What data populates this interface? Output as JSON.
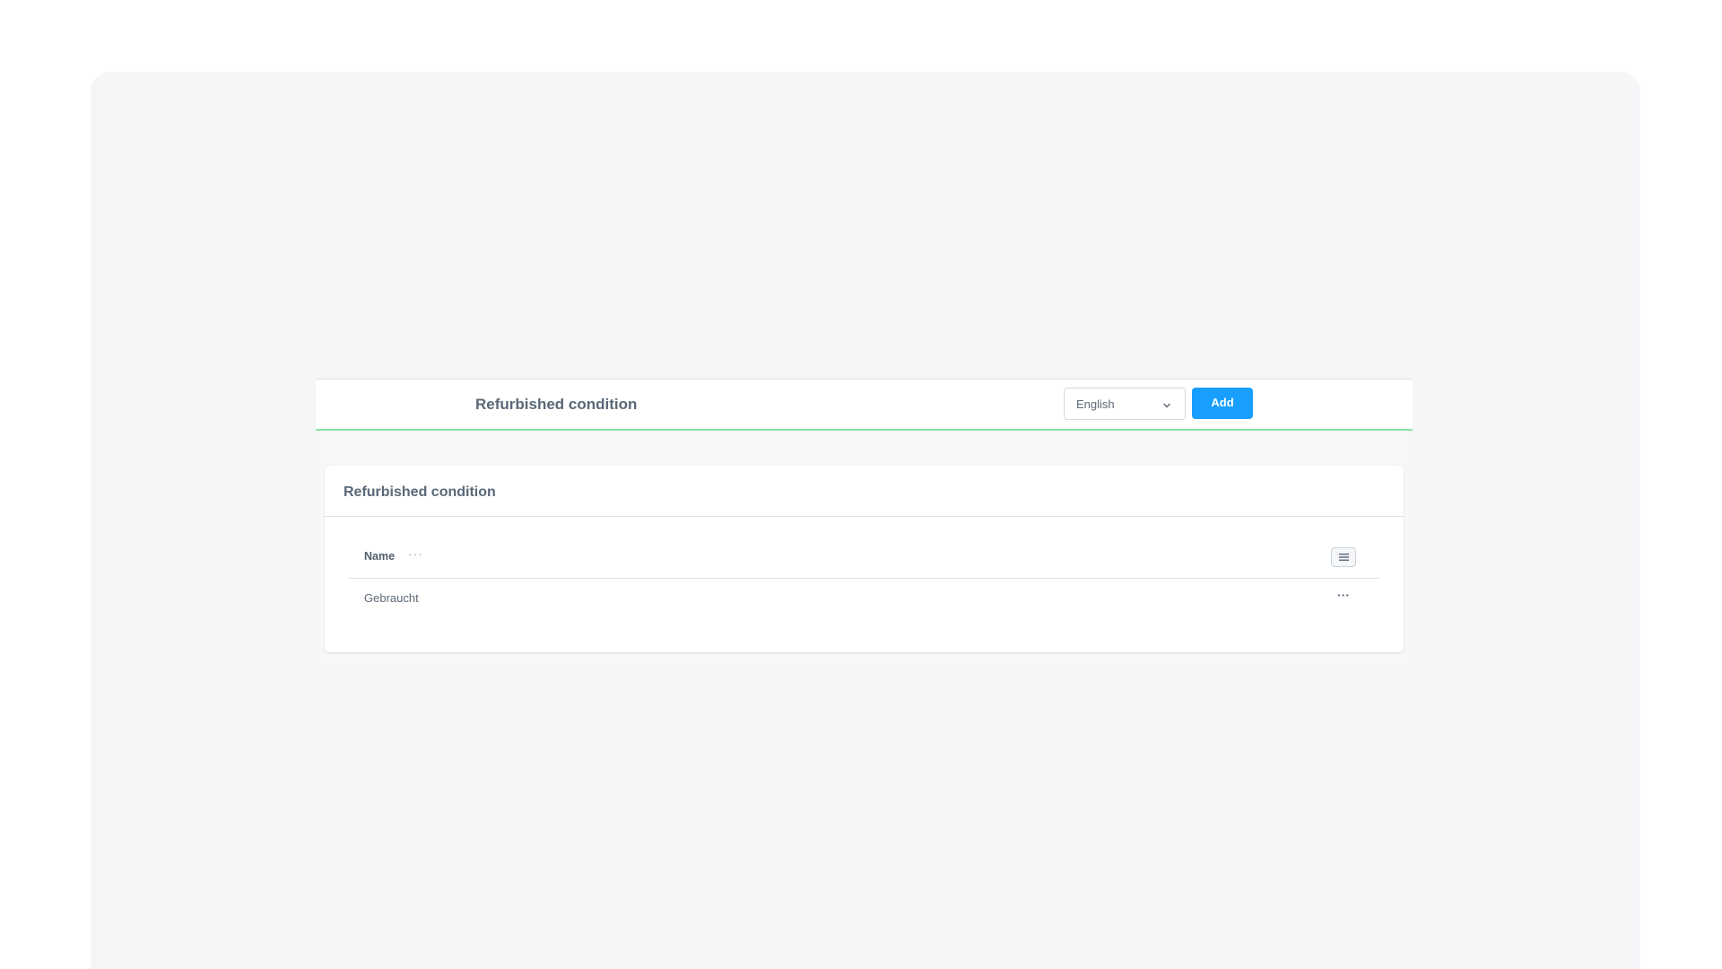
{
  "header": {
    "title": "Refurbished condition",
    "language_select": {
      "selected": "English",
      "icon": "chevron-down-icon"
    },
    "add_label": "Add"
  },
  "card": {
    "title": "Refurbished condition",
    "grid": {
      "columns": [
        {
          "label": "Name",
          "menu_glyph": "···"
        }
      ],
      "settings_icon": "list-settings-icon",
      "rows": [
        {
          "name": "Gebraucht",
          "actions_glyph": "···"
        }
      ]
    }
  },
  "colors": {
    "accent": "#189eff",
    "header_border": "#89e3a2",
    "text": "#5a6878",
    "page_background": "#f4f6f8"
  }
}
